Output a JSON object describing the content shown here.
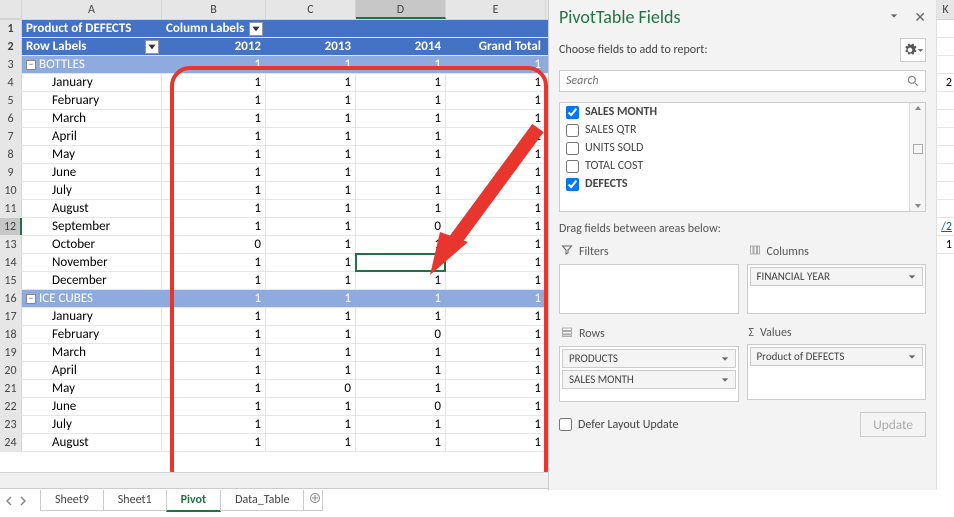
{
  "columns": [
    "A",
    "B",
    "C",
    "D",
    "E"
  ],
  "pt_header": {
    "a": "Product of DEFECTS",
    "b": "Column Labels"
  },
  "pt_sub": {
    "a": "Row Labels",
    "b": "2012",
    "c": "2013",
    "d": "2014",
    "e": "Grand Total"
  },
  "rows": [
    {
      "n": 3,
      "type": "group",
      "a": "BOTTLES",
      "b": "1",
      "c": "1",
      "d": "1",
      "e": "1"
    },
    {
      "n": 4,
      "type": "data",
      "a": "January",
      "b": "1",
      "c": "1",
      "d": "1",
      "e": "1"
    },
    {
      "n": 5,
      "type": "data",
      "a": "February",
      "b": "1",
      "c": "1",
      "d": "1",
      "e": "1"
    },
    {
      "n": 6,
      "type": "data",
      "a": "March",
      "b": "1",
      "c": "1",
      "d": "1",
      "e": "1"
    },
    {
      "n": 7,
      "type": "data",
      "a": "April",
      "b": "1",
      "c": "1",
      "d": "1",
      "e": "1"
    },
    {
      "n": 8,
      "type": "data",
      "a": "May",
      "b": "1",
      "c": "1",
      "d": "1",
      "e": "1"
    },
    {
      "n": 9,
      "type": "data",
      "a": "June",
      "b": "1",
      "c": "1",
      "d": "1",
      "e": "1"
    },
    {
      "n": 10,
      "type": "data",
      "a": "July",
      "b": "1",
      "c": "1",
      "d": "1",
      "e": "1"
    },
    {
      "n": 11,
      "type": "data",
      "a": "August",
      "b": "1",
      "c": "1",
      "d": "1",
      "e": "1"
    },
    {
      "n": 12,
      "type": "data",
      "a": "September",
      "b": "1",
      "c": "1",
      "d": "0",
      "e": "1"
    },
    {
      "n": 13,
      "type": "data",
      "a": "October",
      "b": "0",
      "c": "1",
      "d": "1",
      "e": "1"
    },
    {
      "n": 14,
      "type": "data",
      "a": "November",
      "b": "1",
      "c": "1",
      "d": "1",
      "e": "1"
    },
    {
      "n": 15,
      "type": "data",
      "a": "December",
      "b": "1",
      "c": "1",
      "d": "1",
      "e": "1"
    },
    {
      "n": 16,
      "type": "group",
      "a": "ICE CUBES",
      "b": "1",
      "c": "1",
      "d": "1",
      "e": "1"
    },
    {
      "n": 17,
      "type": "data",
      "a": "January",
      "b": "1",
      "c": "1",
      "d": "1",
      "e": "1"
    },
    {
      "n": 18,
      "type": "data",
      "a": "February",
      "b": "1",
      "c": "1",
      "d": "0",
      "e": "1"
    },
    {
      "n": 19,
      "type": "data",
      "a": "March",
      "b": "1",
      "c": "1",
      "d": "1",
      "e": "1"
    },
    {
      "n": 20,
      "type": "data",
      "a": "April",
      "b": "1",
      "c": "1",
      "d": "1",
      "e": "1"
    },
    {
      "n": 21,
      "type": "data",
      "a": "May",
      "b": "1",
      "c": "0",
      "d": "1",
      "e": "1"
    },
    {
      "n": 22,
      "type": "data",
      "a": "June",
      "b": "1",
      "c": "1",
      "d": "0",
      "e": "1"
    },
    {
      "n": 23,
      "type": "data",
      "a": "July",
      "b": "1",
      "c": "1",
      "d": "1",
      "e": "1"
    },
    {
      "n": 24,
      "type": "data",
      "a": "August",
      "b": "1",
      "c": "1",
      "d": "1",
      "e": "1"
    }
  ],
  "tabs": {
    "t1": "Sheet9",
    "t2": "Sheet1",
    "t3": "Pivot",
    "t4": "Data_Table"
  },
  "panel": {
    "title": "PivotTable Fields",
    "choose": "Choose fields to add to report:",
    "search_ph": "Search",
    "fields": [
      {
        "name": "SALES MONTH",
        "checked": true,
        "bold": true
      },
      {
        "name": "SALES QTR",
        "checked": false,
        "bold": false
      },
      {
        "name": "UNITS SOLD",
        "checked": false,
        "bold": false
      },
      {
        "name": "TOTAL COST",
        "checked": false,
        "bold": false
      },
      {
        "name": "DEFECTS",
        "checked": true,
        "bold": true
      }
    ],
    "drag": "Drag fields between areas below:",
    "filters": "Filters",
    "columns": "Columns",
    "rows": "Rows",
    "values": "Values",
    "col_pill": "FINANCIAL YEAR",
    "row_pill1": "PRODUCTS",
    "row_pill2": "SALES MONTH",
    "val_pill": "Product of DEFECTS",
    "defer": "Defer Layout Update",
    "update": "Update"
  },
  "edge": {
    "hdr": "K",
    "v1": "2",
    "v2": "/2",
    "v3": "1"
  }
}
